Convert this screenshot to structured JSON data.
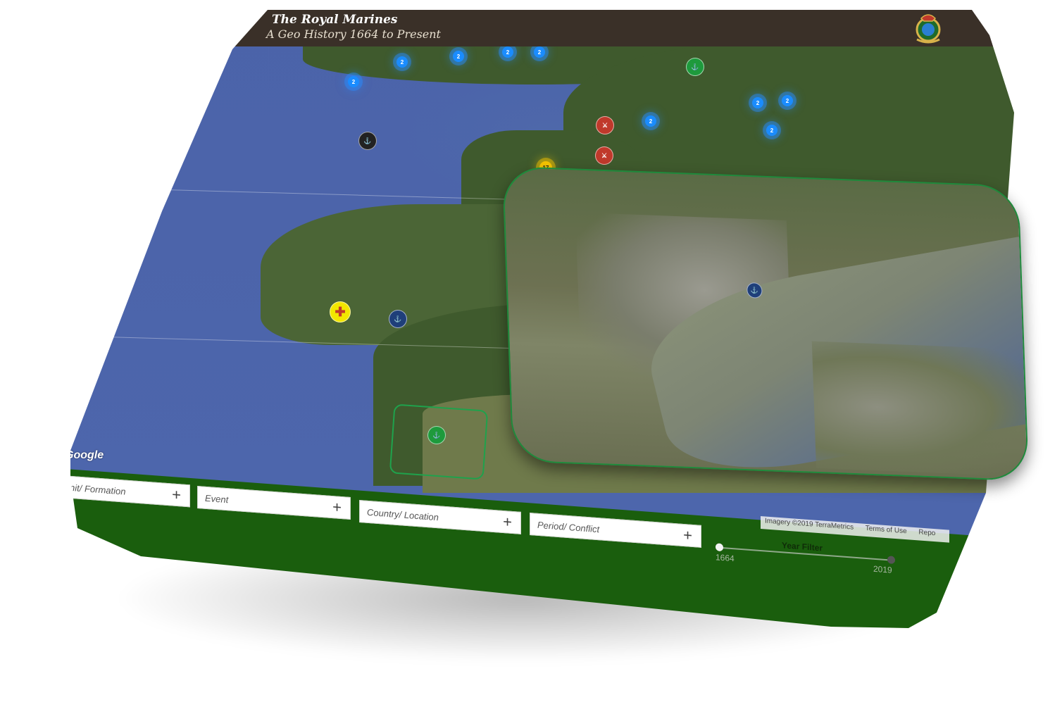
{
  "header": {
    "title": "The Royal Marines",
    "subtitle": "A Geo History 1664 to Present",
    "crest_icon": "royal-marines-crest-icon"
  },
  "map": {
    "provider_logo": "Google",
    "attribution": [
      "Imagery ©2019 TerraMetrics",
      "Terms of Use",
      "Repo"
    ],
    "colors": {
      "sea": "#4b63a9",
      "land": "#3f5a2d",
      "cluster_blue": "#1a8cff",
      "cluster_yellow": "#f6c500",
      "badge_red": "#c0392b",
      "badge_green": "#1e9a3c",
      "badge_navy": "#1f3f7a",
      "badge_dark": "#222222",
      "toolbar": "#1a5e0d"
    },
    "clusters": [
      {
        "count": "2",
        "color": "blue"
      },
      {
        "count": "2",
        "color": "blue"
      },
      {
        "count": "2",
        "color": "blue"
      },
      {
        "count": "2",
        "color": "blue"
      },
      {
        "count": "2",
        "color": "blue"
      },
      {
        "count": "2",
        "color": "blue"
      },
      {
        "count": "2",
        "color": "blue"
      },
      {
        "count": "2",
        "color": "blue"
      },
      {
        "count": "2",
        "color": "blue"
      },
      {
        "count": "17",
        "color": "yellow"
      }
    ],
    "badges": [
      {
        "icon": "unit-badge-green-icon"
      },
      {
        "icon": "unit-badge-red-icon"
      },
      {
        "icon": "unit-badge-red-icon"
      },
      {
        "icon": "unit-badge-dark-icon"
      },
      {
        "icon": "unit-badge-yellow-cross-icon"
      },
      {
        "icon": "unit-badge-navy-icon"
      },
      {
        "icon": "unit-badge-green-icon"
      }
    ],
    "inset": {
      "badge_icon": "unit-badge-navy-icon"
    }
  },
  "filters": {
    "unit": {
      "placeholder": "nit/ Formation"
    },
    "event": {
      "placeholder": "Event"
    },
    "country": {
      "placeholder": "Country/ Location"
    },
    "period": {
      "placeholder": "Period/ Conflict"
    },
    "plus": "+"
  },
  "year_filter": {
    "label": "Year Filter",
    "min": "1664",
    "max": "2019",
    "range_start_fraction": 0,
    "range_end_fraction": 1
  }
}
